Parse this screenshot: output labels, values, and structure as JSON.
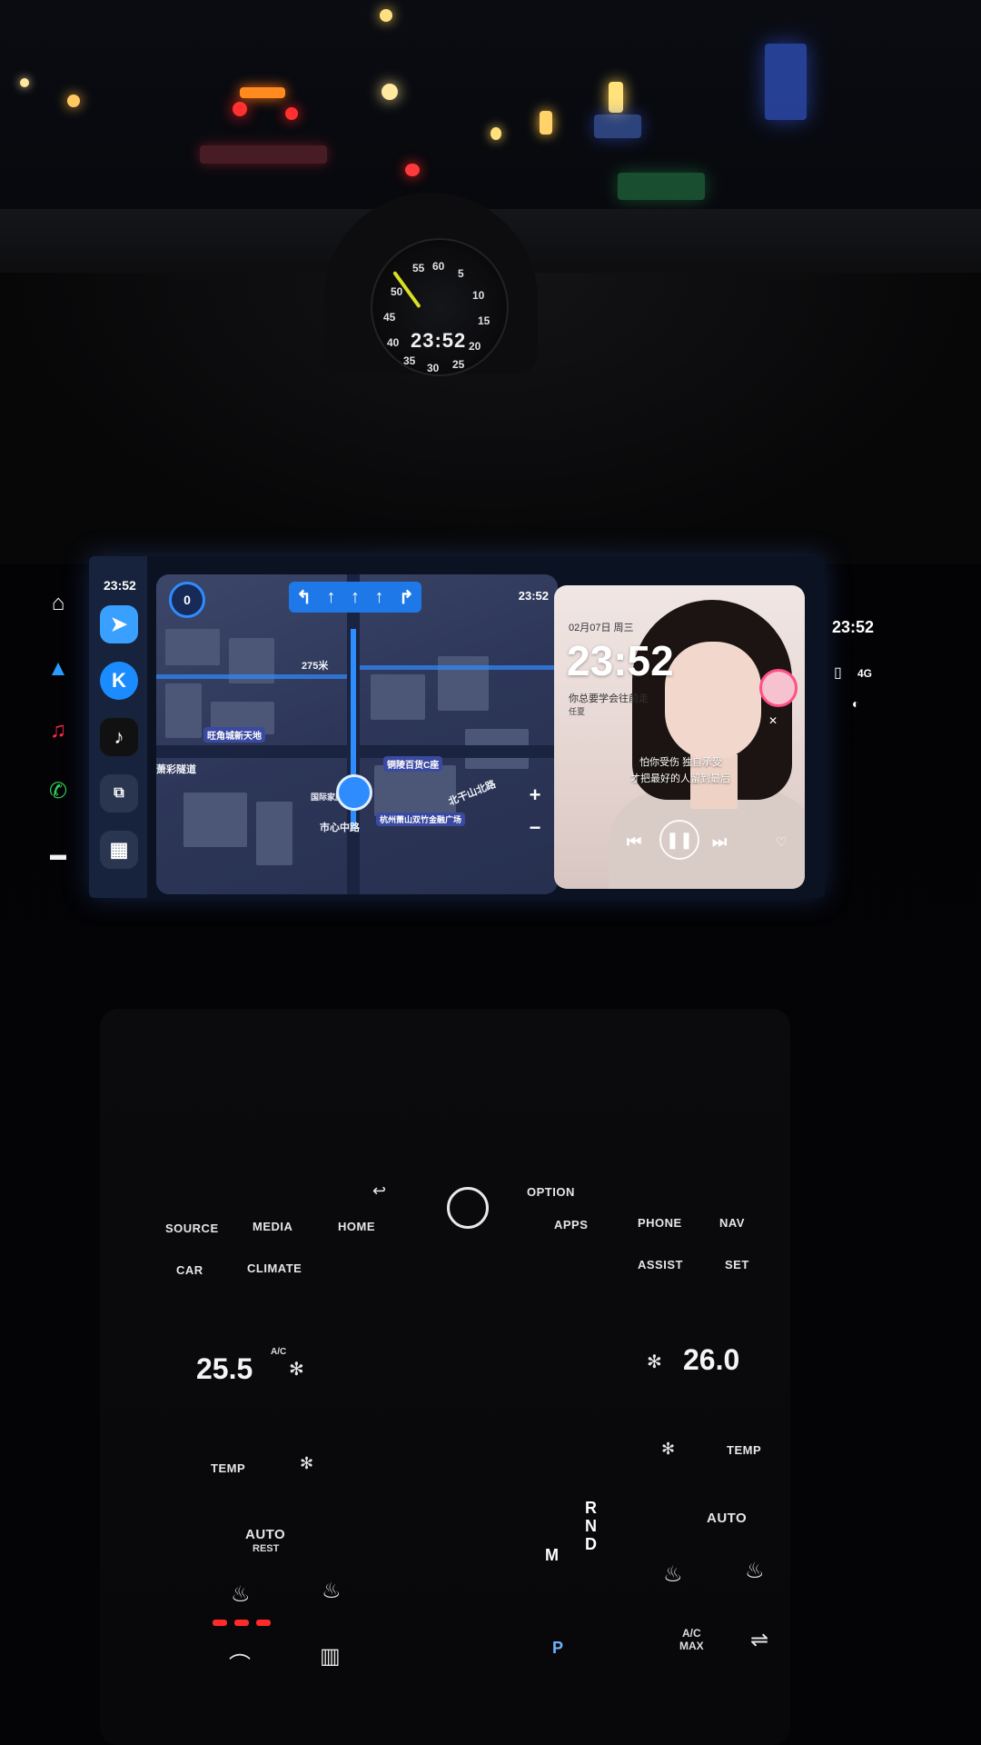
{
  "clock": {
    "digital": "23:52",
    "numbers": [
      "55",
      "60",
      "5",
      "10",
      "15",
      "20",
      "25",
      "30",
      "35",
      "40",
      "45",
      "50"
    ]
  },
  "screen": {
    "status_time": "23:52",
    "right_time": "23:52",
    "right_signal": "4G",
    "map": {
      "speed": "0",
      "time": "23:52",
      "labels": [
        "275米",
        "旺角城新天地",
        "铜陵百货C座",
        "市心中路",
        "杭州萧山双竹金融广场",
        "北干山北路",
        "萧彩隧道",
        "国际家庭"
      ],
      "zoom_in": "+",
      "zoom_out": "−"
    },
    "music": {
      "date": "02月07日 周三",
      "time": "23:52",
      "lyric_top": "你总要学会往前走",
      "lyric_artist": "任夏",
      "lyric_1": "怕你受伤 独自承受",
      "lyric_2": "才把最好的人留到最后"
    }
  },
  "console": {
    "buttons": [
      "SOURCE",
      "MEDIA",
      "HOME",
      "OPTION",
      "APPS",
      "PHONE",
      "NAV",
      "CAR",
      "CLIMATE",
      "ASSIST",
      "SET"
    ],
    "temp_left": "25.5",
    "temp_right": "26.0",
    "ac_label": "A/C",
    "temp_label": "TEMP",
    "auto_label": "AUTO",
    "rest_label": "REST",
    "ac_max": "A/C\nMAX",
    "gear_letters": [
      "R",
      "N",
      "D",
      "M",
      "P"
    ]
  }
}
